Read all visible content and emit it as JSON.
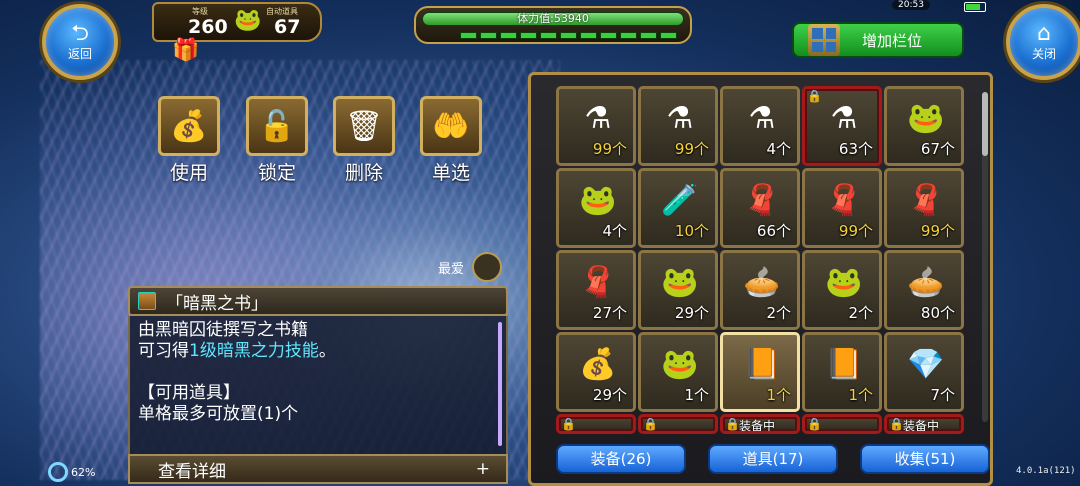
{
  "header": {
    "back_label": "返回",
    "close_label": "关闭",
    "level_label": "等级",
    "level_value": "260",
    "auto_item_label": "自动道具",
    "auto_item_value": "67",
    "stamina_text": "体力值:53940",
    "time": "20:53",
    "add_slot_label": "增加栏位"
  },
  "actions": [
    {
      "label": "使用",
      "icon": "bag-icon"
    },
    {
      "label": "锁定",
      "icon": "padlock-icon"
    },
    {
      "label": "删除",
      "icon": "trash-icon"
    },
    {
      "label": "单选",
      "icon": "hand-select-icon"
    }
  ],
  "favorite_label": "最爱",
  "item_detail": {
    "name": "「暗黑之书」",
    "line1": "由黑暗囚徒撰写之书籍",
    "line2_prefix": "可习得",
    "line2_highlight": "1级暗黑之力技能",
    "line2_suffix": "。",
    "section": "【可用道具】",
    "stack_note": "单格最多可放置(1)个",
    "more_label": "查看详细",
    "more_plus": "+"
  },
  "status": {
    "battery_percent": "62%",
    "version": "4.0.1a(121)"
  },
  "inventory": {
    "rows": [
      [
        {
          "icon": "red-potion-icon",
          "count": "99个",
          "gold": true
        },
        {
          "icon": "red-potion-icon",
          "count": "99个",
          "gold": true
        },
        {
          "icon": "red-potion-icon",
          "count": "4个",
          "gold": false
        },
        {
          "icon": "yellow-potion-icon",
          "count": "63个",
          "gold": false,
          "locked": true
        },
        {
          "icon": "frog-pot-icon",
          "count": "67个",
          "gold": false
        }
      ],
      [
        {
          "icon": "frog-pot-icon",
          "count": "4个",
          "gold": false
        },
        {
          "icon": "green-flask-icon",
          "count": "10个",
          "gold": true
        },
        {
          "icon": "blue-scarf-icon",
          "count": "66个",
          "gold": false
        },
        {
          "icon": "blue-scarf-icon",
          "count": "99个",
          "gold": true
        },
        {
          "icon": "blue-scarf-icon",
          "count": "99个",
          "gold": true
        }
      ],
      [
        {
          "icon": "blue-scarf-icon",
          "count": "27个",
          "gold": false
        },
        {
          "icon": "frog-pot-icon",
          "count": "29个",
          "gold": false
        },
        {
          "icon": "pie-icon",
          "count": "2个",
          "gold": false
        },
        {
          "icon": "frog-pot-icon",
          "count": "2个",
          "gold": false
        },
        {
          "icon": "pie-icon",
          "count": "80个",
          "gold": false
        }
      ],
      [
        {
          "icon": "pouch-icon",
          "count": "29个",
          "gold": false
        },
        {
          "icon": "frog-pot-icon",
          "count": "1个",
          "gold": false
        },
        {
          "icon": "dark-book-icon",
          "count": "1个",
          "gold": true,
          "selected": true
        },
        {
          "icon": "dark-book-icon",
          "count": "1个",
          "gold": true
        },
        {
          "icon": "blue-crystal-icon",
          "count": "7个",
          "gold": false
        }
      ]
    ],
    "partial_row": [
      {
        "tag": ""
      },
      {
        "tag": ""
      },
      {
        "tag": "装备中"
      },
      {
        "tag": ""
      },
      {
        "tag": "装备中"
      }
    ]
  },
  "tabs": [
    {
      "label": "装备(26)"
    },
    {
      "label": "道具(17)"
    },
    {
      "label": "收集(51)"
    }
  ],
  "colors": {
    "accent_gold": "#c9a34a",
    "highlight_cyan": "#5fe6ff",
    "count_gold": "#f5d23a",
    "lock_red": "#a21a1a"
  }
}
